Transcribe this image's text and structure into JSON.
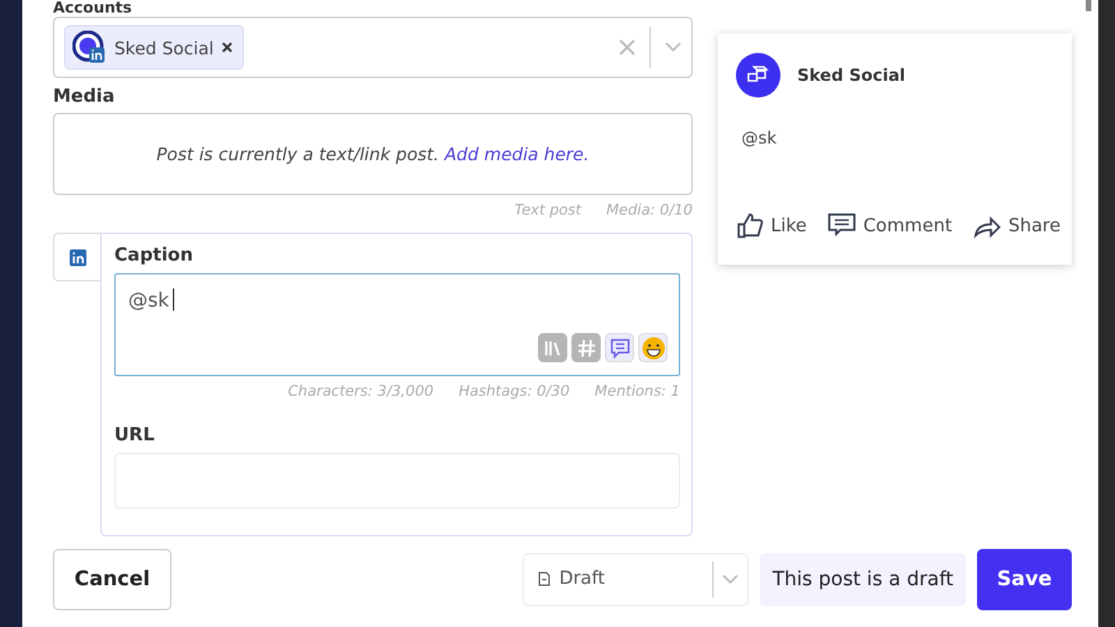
{
  "accounts": {
    "label": "Accounts",
    "chips": [
      {
        "name": "Sked Social"
      }
    ]
  },
  "media": {
    "label": "Media",
    "message": "Post is currently a text/link post. *Add media here.*",
    "counters": [
      "Text post",
      "Media: 0/10"
    ]
  },
  "caption": {
    "label": "Caption",
    "value": "@sk",
    "tools": [
      {
        "kind": "library",
        "active": false
      },
      {
        "kind": "hashtag",
        "active": false
      },
      {
        "kind": "comment",
        "active": true
      },
      {
        "kind": "emoji",
        "active": true
      }
    ],
    "counters": [
      "Characters: 3/3,000",
      "Hashtags: 0/30",
      "Mentions: 1"
    ]
  },
  "url": {
    "label": "URL"
  },
  "footer": {
    "cancel": "Cancel",
    "status": {
      "value": "Draft"
    },
    "note": "This post is a draft",
    "save": "Save"
  },
  "preview": {
    "account": "Sked Social",
    "text": "@sk",
    "actions": [
      {
        "kind": "like",
        "label": "Like"
      },
      {
        "kind": "comment",
        "label": "Comment"
      },
      {
        "kind": "share",
        "label": "Share"
      }
    ]
  }
}
